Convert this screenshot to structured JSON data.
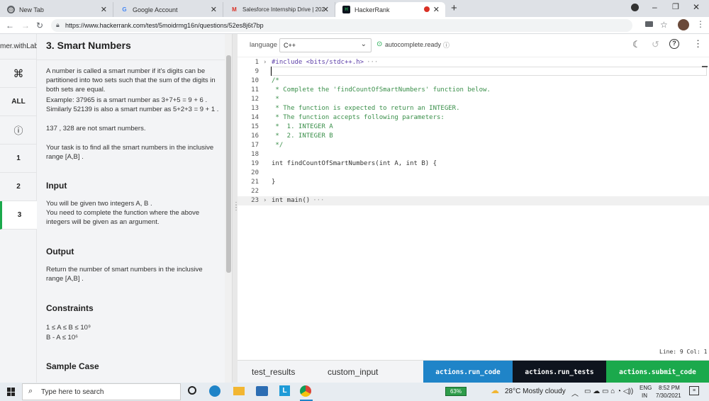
{
  "browser": {
    "tabs": [
      {
        "label": "New Tab"
      },
      {
        "label": "Google Account"
      },
      {
        "label": "Salesforce Internship Drive | 202"
      },
      {
        "label": "HackerRank"
      }
    ],
    "url": "https://www.hackerrank.com/test/5moidrmg16n/questions/52es8j6t7bp"
  },
  "left_nav": {
    "header": "mer.withLab",
    "items": [
      {
        "label": "⌘"
      },
      {
        "label": "ALL"
      },
      {
        "label": "ⓘ"
      },
      {
        "label": "1"
      },
      {
        "label": "2"
      },
      {
        "label": "3"
      }
    ]
  },
  "problem": {
    "title": "3. Smart Numbers",
    "desc1": "A number is called a smart number if it's digits can be partitioned into two sets such that the sum of the digits in both sets are equal.",
    "desc2": "Example:  37965 is a smart number as 3+7+5 = 9 + 6 . Similarly 52139 is also a smart number as 5+2+3 = 9 + 1 .",
    "desc3": "137 , 328 are not smart numbers.",
    "desc4": "Your task is to find all the smart numbers in the inclusive range [A,B] .",
    "input_heading": "Input",
    "input1": "You will be given two integers A, B .",
    "input2": "You need to complete the function where the above integers will be given as an argument.",
    "output_heading": "Output",
    "output1": "Return the number of smart numbers in the inclusive range [A,B] .",
    "constraints_heading": "Constraints",
    "constraint1": "1 ≤ A ≤ B ≤ 10⁹",
    "constraint2": "B - A ≤ 10⁶",
    "sample_heading": "Sample Case"
  },
  "editor": {
    "language_label": "language",
    "language_value": "C++",
    "autocomplete": "autocomplete.ready",
    "lines": [
      {
        "num": "1",
        "code": "#include <bits/stdc++.h>",
        "fold": true
      },
      {
        "num": "9",
        "code": ""
      },
      {
        "num": "10",
        "code": "/*"
      },
      {
        "num": "11",
        "code": " * Complete the 'findCountOfSmartNumbers' function below."
      },
      {
        "num": "12",
        "code": " *"
      },
      {
        "num": "13",
        "code": " * The function is expected to return an INTEGER."
      },
      {
        "num": "14",
        "code": " * The function accepts following parameters:"
      },
      {
        "num": "15",
        "code": " *  1. INTEGER A"
      },
      {
        "num": "16",
        "code": " *  2. INTEGER B"
      },
      {
        "num": "17",
        "code": " */"
      },
      {
        "num": "18",
        "code": ""
      },
      {
        "num": "19",
        "code": "int findCountOfSmartNumbers(int A, int B) {"
      },
      {
        "num": "20",
        "code": ""
      },
      {
        "num": "21",
        "code": "}"
      },
      {
        "num": "22",
        "code": ""
      },
      {
        "num": "23",
        "code": "int main()",
        "fold": true
      }
    ],
    "status": "Line: 9 Col: 1"
  },
  "bottom": {
    "tab1": "test_results",
    "tab2": "custom_input",
    "run_code": "actions.run_code",
    "run_tests": "actions.run_tests",
    "submit": "actions.submit_code"
  },
  "taskbar": {
    "search_placeholder": "Type here to search",
    "battery": "63%",
    "weather": "28°C  Mostly cloudy",
    "lang1": "ENG",
    "lang2": "IN",
    "time": "8:52 PM",
    "date": "7/30/2021"
  },
  "colors": {
    "accent": "#1ba94c",
    "run_code": "#1f84c8",
    "run_tests": "#0e141e",
    "submit": "#1ba94c"
  }
}
